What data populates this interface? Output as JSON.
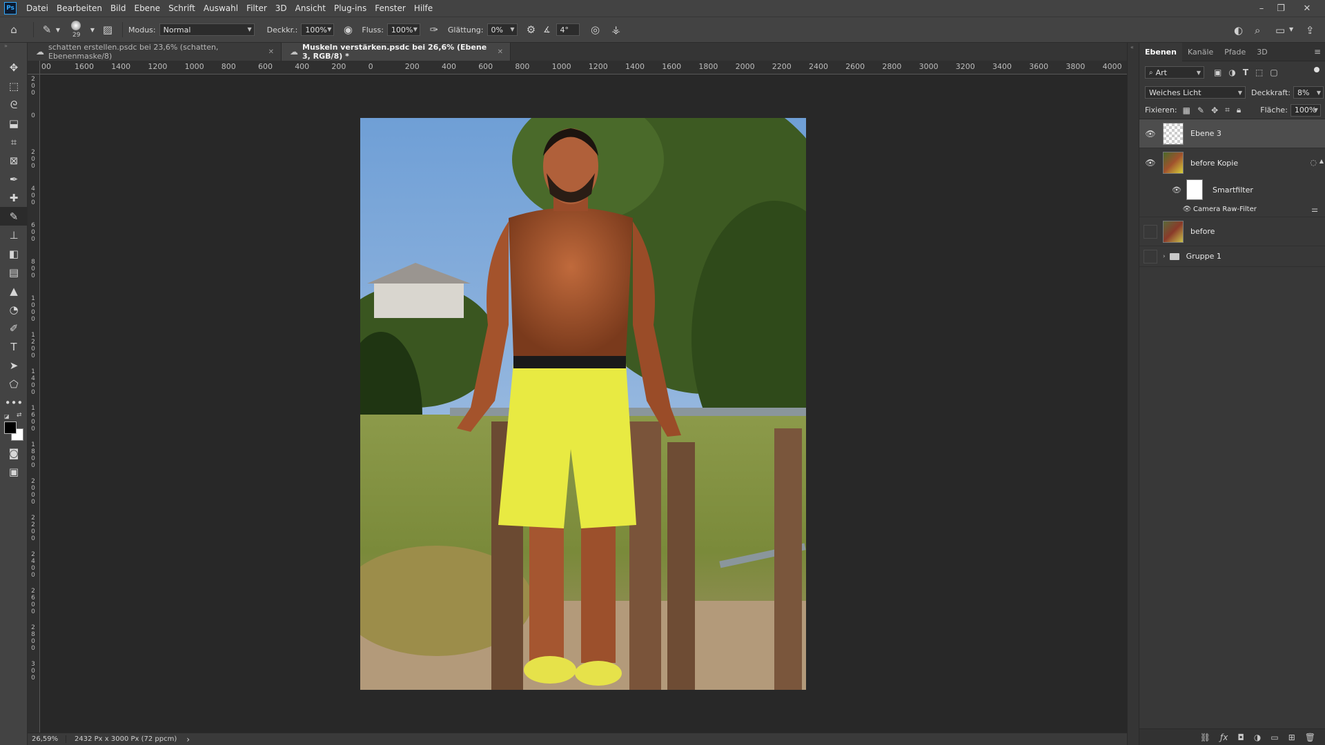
{
  "menubar": {
    "logo": "Ps",
    "items": [
      "Datei",
      "Bearbeiten",
      "Bild",
      "Ebene",
      "Schrift",
      "Auswahl",
      "Filter",
      "3D",
      "Ansicht",
      "Plug-ins",
      "Fenster",
      "Hilfe"
    ]
  },
  "options": {
    "brush_size": "29",
    "mode_label": "Modus:",
    "mode_value": "Normal",
    "opacity_label": "Deckkr.:",
    "opacity_value": "100%",
    "flow_label": "Fluss:",
    "flow_value": "100%",
    "smoothing_label": "Glättung:",
    "smoothing_value": "0%",
    "angle_value": "4°"
  },
  "tabs": [
    {
      "label": "schatten erstellen.psdc bei 23,6% (schatten, Ebenenmaske/8)",
      "active": false
    },
    {
      "label": "Muskeln verstärken.psdc bei 26,6% (Ebene 3, RGB/8) *",
      "active": true
    }
  ],
  "ruler_top": [
    "00",
    "1600",
    "1400",
    "1200",
    "1000",
    "800",
    "600",
    "400",
    "200",
    "0",
    "200",
    "400",
    "600",
    "800",
    "1000",
    "1200",
    "1400",
    "1600",
    "1800",
    "2000",
    "2200",
    "2400",
    "2600",
    "2800",
    "3000",
    "3200",
    "3400",
    "3600",
    "3800",
    "4000"
  ],
  "ruler_left": [
    "200",
    "0",
    "200",
    "400",
    "600",
    "800",
    "1000",
    "1200",
    "1400",
    "1600",
    "1800",
    "2000",
    "2200",
    "2400",
    "2600",
    "2800",
    "300"
  ],
  "status": {
    "zoom": "26,59%",
    "doc_info": "2432 Px x 3000 Px (72 ppcm)",
    "arrow": "›"
  },
  "layers_panel": {
    "tabs": [
      "Ebenen",
      "Kanäle",
      "Pfade",
      "3D"
    ],
    "filter_kind": "Art",
    "blend_mode": "Weiches Licht",
    "opacity_label": "Deckkraft:",
    "opacity_value": "8%",
    "lock_label": "Fixieren:",
    "fill_label": "Fläche:",
    "fill_value": "100%",
    "layers": [
      {
        "name": "Ebene 3",
        "visible": true,
        "selected": true
      },
      {
        "name": "before Kopie",
        "visible": true,
        "selected": false
      },
      {
        "name": "Smartfilter",
        "visible": true,
        "selected": false
      },
      {
        "name": "Camera Raw-Filter",
        "visible": true,
        "selected": false
      },
      {
        "name": "before",
        "visible": false,
        "selected": false
      },
      {
        "name": "Gruppe 1",
        "visible": false,
        "selected": false
      }
    ]
  },
  "colors": {
    "ui_dark": "#282828",
    "ui_panel": "#434343",
    "selection": "#4d4d4d",
    "accent": "#31a8ff"
  }
}
